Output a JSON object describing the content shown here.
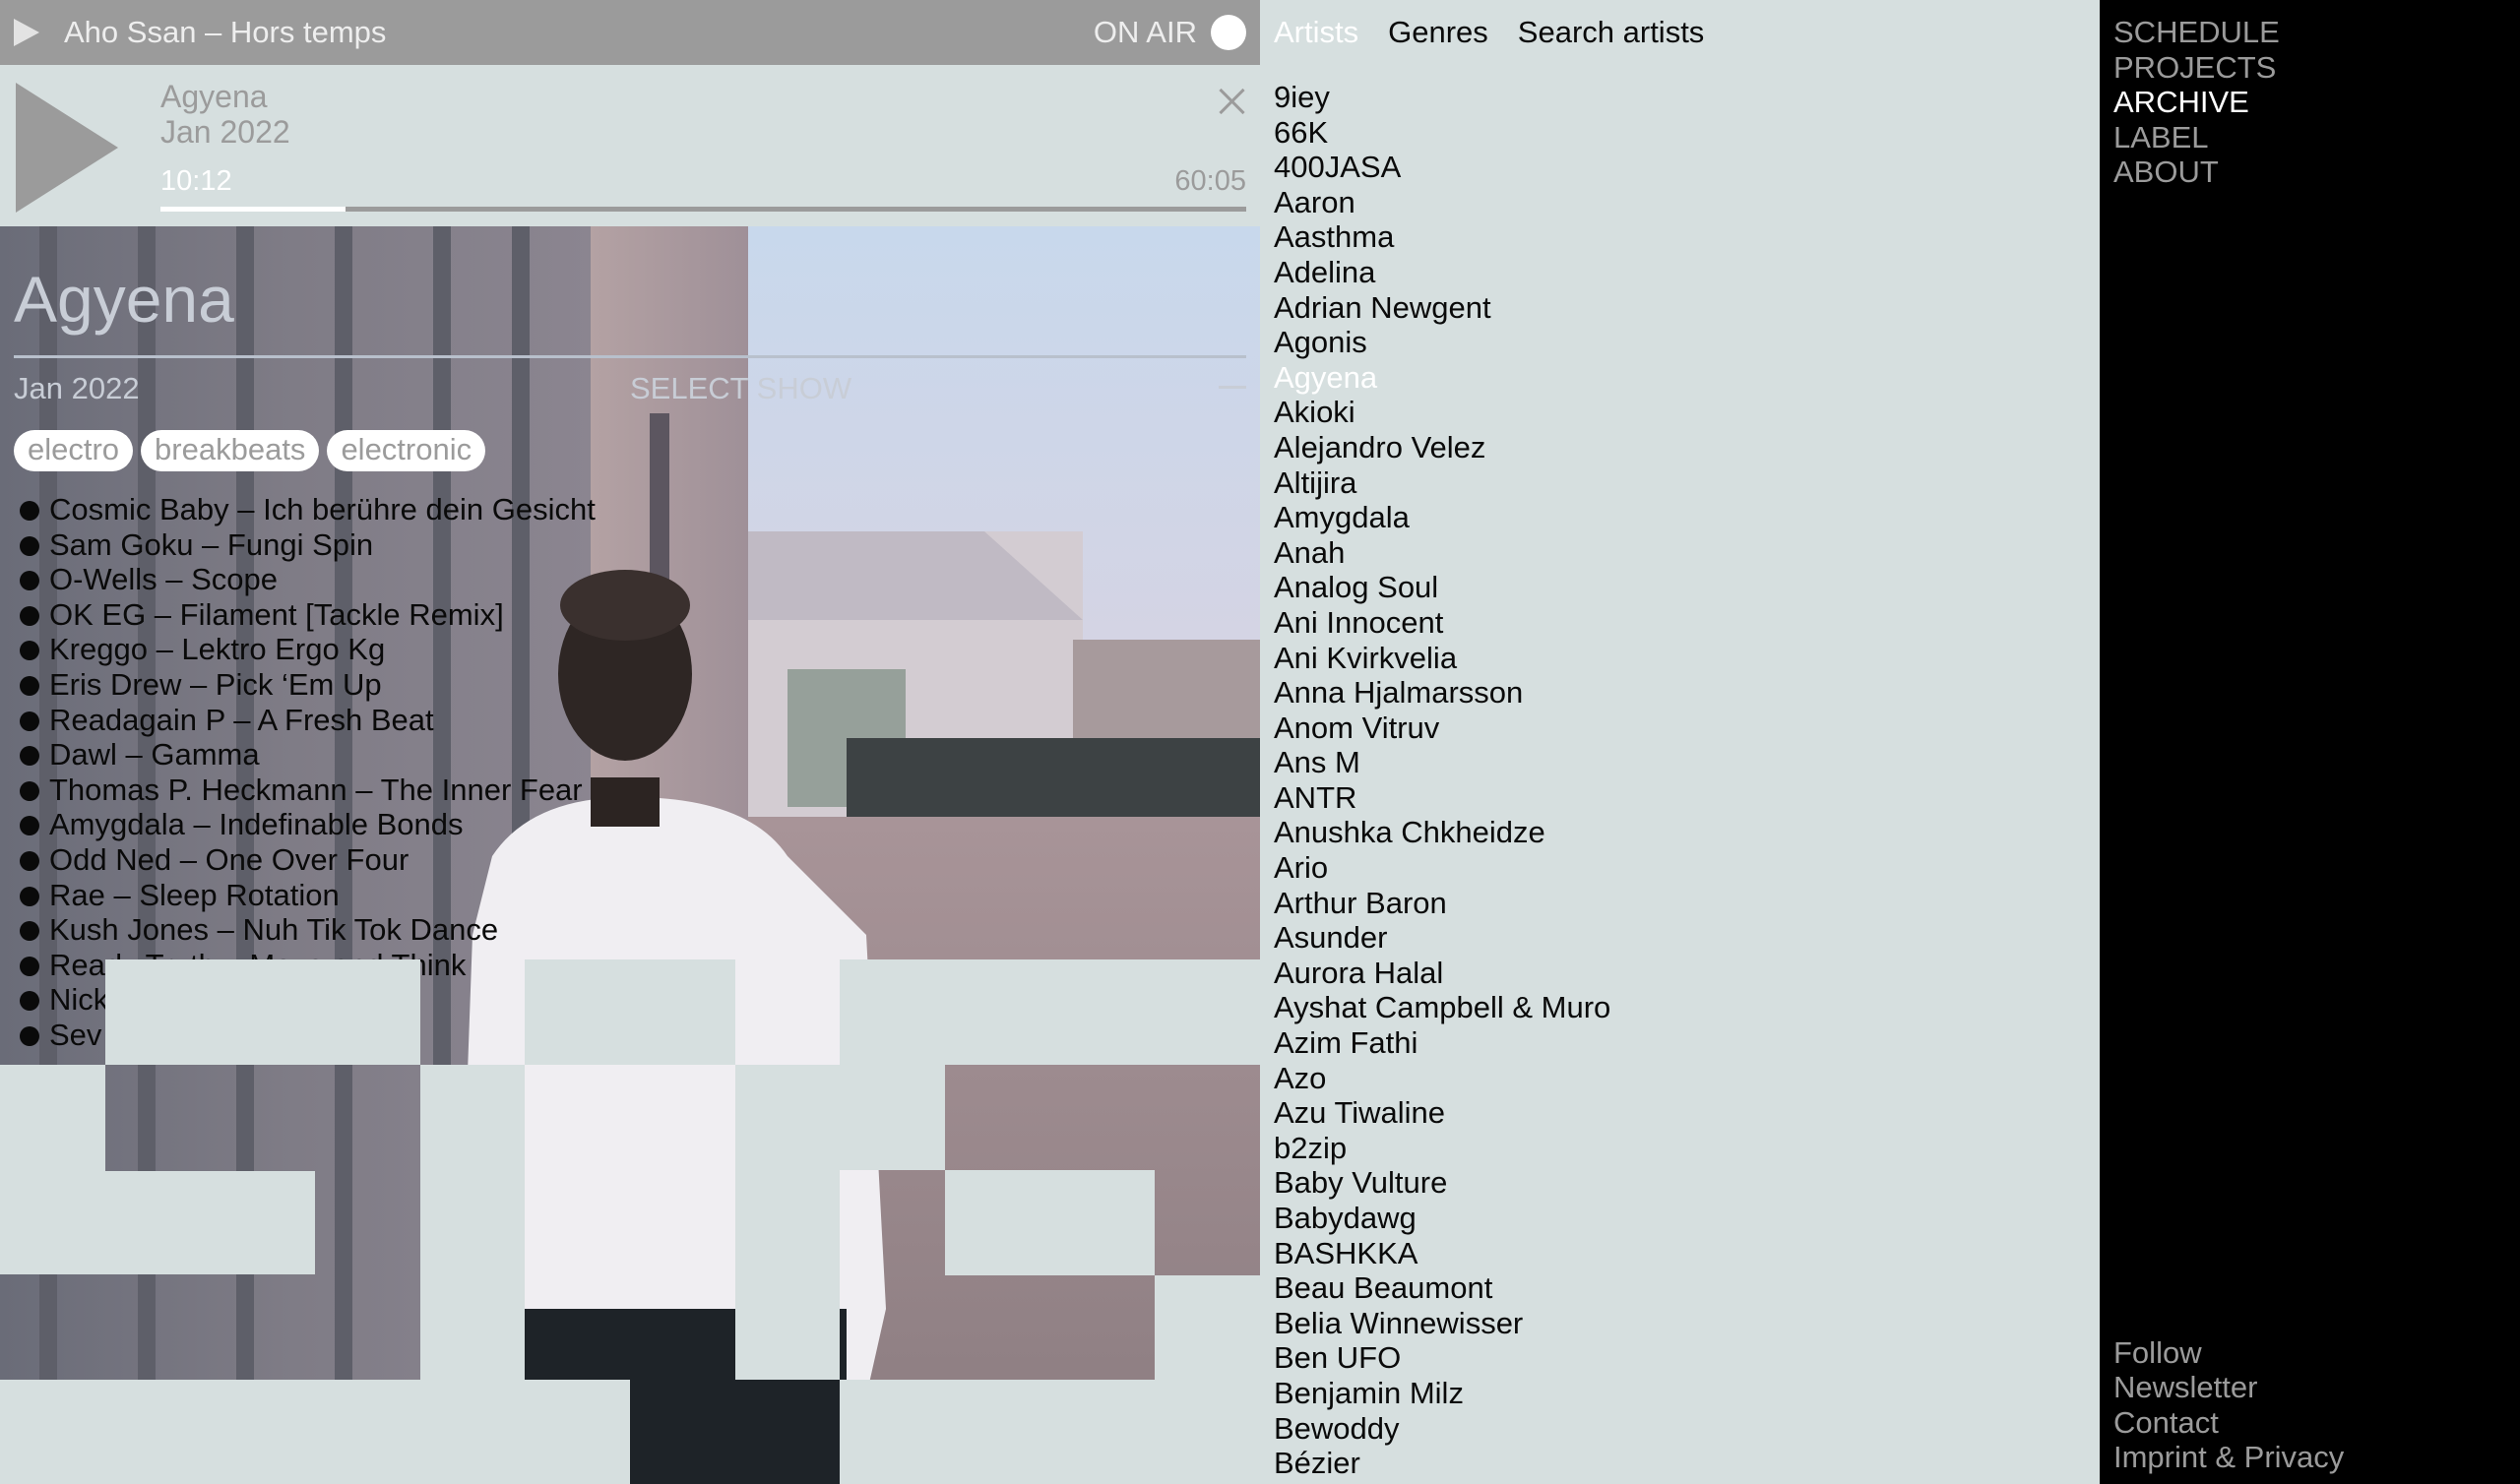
{
  "live": {
    "title": "Aho Ssan – Hors temps",
    "on_air_label": "ON AIR"
  },
  "player": {
    "artist": "Agyena",
    "date": "Jan 2022",
    "elapsed": "10:12",
    "total": "60:05",
    "progress": 0.17
  },
  "show": {
    "title": "Agyena",
    "date": "Jan 2022",
    "select_label": "SELECT SHOW",
    "tags": [
      "electro",
      "breakbeats",
      "electronic"
    ],
    "tracks": [
      "Cosmic Baby – Ich berühre dein Gesicht",
      "Sam Goku – Fungi Spin",
      "O-Wells – Scope",
      "OK EG – Filament [Tackle Remix]",
      "Kreggo – Lektro Ergo Kg",
      "Eris Drew – Pick ‘Em Up",
      "Readagain P – A Fresh Beat",
      "Dawl – Gamma",
      "Thomas P. Heckmann – The Inner Fear",
      "Amygdala – Indefinable Bonds",
      "Odd Ned – One Over Four",
      "Rae – Sleep Rotation",
      "Kush Jones – Nuh Tik Tok Dance",
      "Ready Truth – Move and Think",
      "Nick",
      "Sev"
    ]
  },
  "artists_panel": {
    "tabs": [
      "Artists",
      "Genres",
      "Search artists"
    ],
    "active_tab": "Artists",
    "selected_artist": "Agyena",
    "artists": [
      "9iey",
      "66K",
      "400JASA",
      "Aaron",
      "Aasthma",
      "Adelina",
      "Adrian Newgent",
      "Agonis",
      "Agyena",
      "Akioki",
      "Alejandro Velez",
      "Altijira",
      "Amygdala",
      "Anah",
      "Analog Soul",
      "Ani Innocent",
      "Ani Kvirkvelia",
      "Anna Hjalmarsson",
      "Anom Vitruv",
      "Ans M",
      "ANTR",
      "Anushka Chkheidze",
      "Ario",
      "Arthur Baron",
      "Asunder",
      "Aurora Halal",
      "Ayshat Campbell & Muro",
      "Azim Fathi",
      "Azo",
      "Azu Tiwaline",
      "b2zip",
      "Baby Vulture",
      "Babydawg",
      "BASHKKA",
      "Beau Beaumont",
      "Belia Winnewisser",
      "Ben UFO",
      "Benjamin Milz",
      "Bewoddy",
      "Bézier"
    ]
  },
  "nav": {
    "items": [
      "SCHEDULE",
      "PROJECTS",
      "ARCHIVE",
      "LABEL",
      "ABOUT"
    ],
    "active": "ARCHIVE",
    "footer": [
      "Follow",
      "Newsletter",
      "Contact",
      "Imprint & Privacy"
    ]
  },
  "icons": {
    "live_play": "play-icon",
    "player_play": "play-icon",
    "close": "close-icon",
    "on_air": "live-dot-icon",
    "collapse": "minus-icon"
  },
  "colors": {
    "background": "#d6dfdf",
    "live_bar": "#9b9b9b",
    "muted": "#9b9b9b",
    "text": "#0a0a0a",
    "active": "#ffffff",
    "nav_background": "#000000"
  }
}
